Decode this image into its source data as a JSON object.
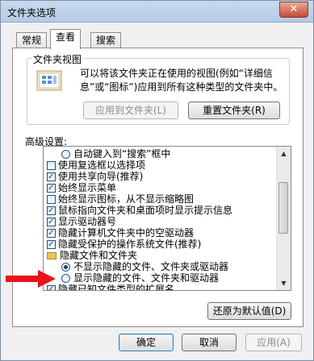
{
  "window": {
    "title": "文件夹选项",
    "close_glyph": "✕"
  },
  "tabs": [
    {
      "label": "常规",
      "active": false
    },
    {
      "label": "查看",
      "active": true
    },
    {
      "label": "搜索",
      "active": false
    }
  ],
  "folder_view": {
    "title": "文件夹视图",
    "description": "可以将该文件夹正在使用的视图(例如“详细信息”或“图标”)应用到所有这种类型的文件夹中。",
    "apply_button": "应用到文件夹(L)",
    "reset_button": "重置文件夹(R)"
  },
  "advanced": {
    "label": "高级设置:",
    "items": [
      {
        "type": "radio",
        "checked": false,
        "indent": 1,
        "text": "自动键入到“搜索”框中"
      },
      {
        "type": "checkbox",
        "checked": false,
        "indent": 0,
        "text": "使用复选框以选择项"
      },
      {
        "type": "checkbox",
        "checked": true,
        "indent": 0,
        "text": "使用共享向导(推荐)"
      },
      {
        "type": "checkbox",
        "checked": true,
        "indent": 0,
        "text": "始终显示菜单"
      },
      {
        "type": "checkbox",
        "checked": false,
        "indent": 0,
        "text": "始终显示图标，从不显示缩略图"
      },
      {
        "type": "checkbox",
        "checked": true,
        "indent": 0,
        "text": "鼠标指向文件夹和桌面项时显示提示信息"
      },
      {
        "type": "checkbox",
        "checked": true,
        "indent": 0,
        "text": "显示驱动器号"
      },
      {
        "type": "checkbox",
        "checked": true,
        "indent": 0,
        "text": "隐藏计算机文件夹中的空驱动器"
      },
      {
        "type": "checkbox",
        "checked": true,
        "indent": 0,
        "text": "隐藏受保护的操作系统文件(推荐)"
      },
      {
        "type": "folder",
        "checked": false,
        "indent": 0,
        "text": "隐藏文件和文件夹"
      },
      {
        "type": "radio",
        "checked": true,
        "indent": 1,
        "text": "不显示隐藏的文件、文件夹或驱动器"
      },
      {
        "type": "radio",
        "checked": false,
        "indent": 1,
        "text": "显示隐藏的文件、文件夹和驱动器"
      },
      {
        "type": "checkbox",
        "checked": true,
        "indent": 0,
        "text": "隐藏已知文件类型的扩展名"
      }
    ],
    "restore_button": "还原为默认值(D)"
  },
  "footer": {
    "ok_button": "确定",
    "cancel_button": "取消",
    "apply_button": "应用(A)"
  },
  "colors": {
    "arrow": "#e8131a"
  }
}
